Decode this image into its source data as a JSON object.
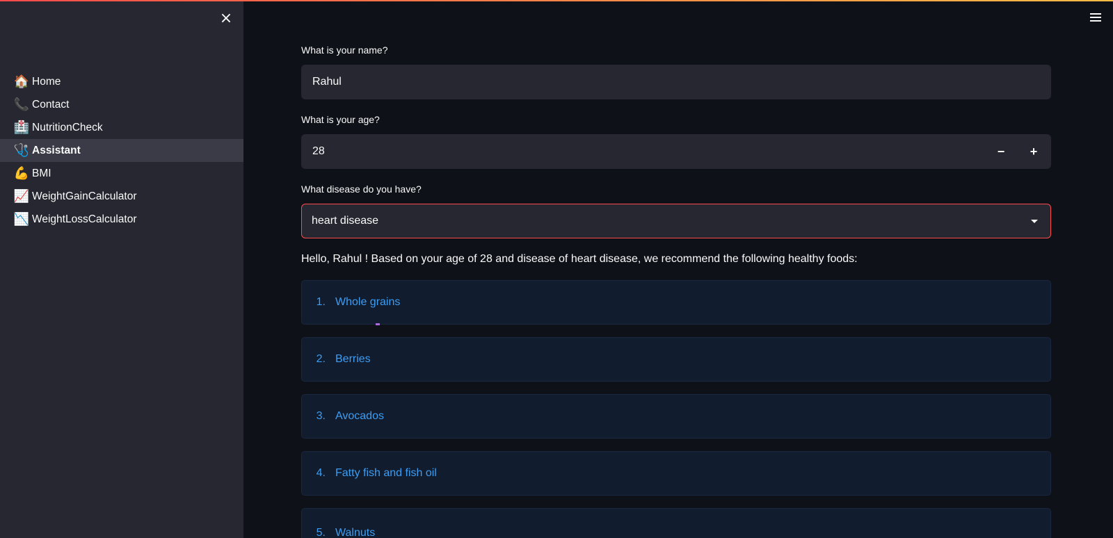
{
  "sidebar": {
    "close_icon": "×",
    "items": [
      {
        "label": "Home",
        "icon": "🏠",
        "icon_name": "house-icon",
        "active": false
      },
      {
        "label": "Contact",
        "icon": "📞",
        "icon_name": "telephone-icon",
        "active": false
      },
      {
        "label": "NutritionCheck",
        "icon": "🏥",
        "icon_name": "hospital-icon",
        "active": false
      },
      {
        "label": "Assistant",
        "icon": "🩺",
        "icon_name": "stethoscope-icon",
        "active": true
      },
      {
        "label": "BMI",
        "icon": "💪",
        "icon_name": "flexed-biceps-icon",
        "active": false
      },
      {
        "label": "WeightGainCalculator",
        "icon": "📈",
        "icon_name": "chart-increasing-icon",
        "active": false
      },
      {
        "label": "WeightLossCalculator",
        "icon": "📉",
        "icon_name": "chart-decreasing-icon",
        "active": false
      }
    ]
  },
  "form": {
    "name_label": "What is your name?",
    "name_value": "Rahul",
    "age_label": "What is your age?",
    "age_value": "28",
    "age_minus": "−",
    "age_plus": "+",
    "disease_label": "What disease do you have?",
    "disease_value": "heart disease"
  },
  "recommendation": {
    "message": "Hello, Rahul ! Based on your age of 28 and disease of heart disease, we recommend the following healthy foods:",
    "foods": [
      {
        "num": "1.",
        "name": "Whole grains"
      },
      {
        "num": "2.",
        "name": "Berries"
      },
      {
        "num": "3.",
        "name": "Avocados"
      },
      {
        "num": "4.",
        "name": "Fatty fish and fish oil"
      },
      {
        "num": "5.",
        "name": "Walnuts"
      }
    ]
  },
  "colors": {
    "background": "#0e1117",
    "sidebar": "#262730",
    "accent": "#ff4b4b",
    "link": "#3d9df3",
    "card": "#111c2e"
  }
}
